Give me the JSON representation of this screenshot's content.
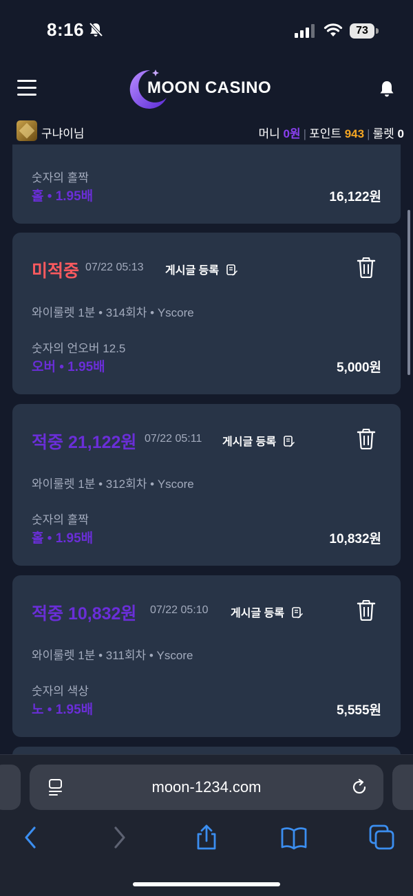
{
  "status_bar": {
    "time": "8:16",
    "battery": "73"
  },
  "header": {
    "logo_text": "MOON CASINO"
  },
  "user": {
    "name": "구냐이님",
    "money_label": "머니",
    "money_value": "0원",
    "point_label": "포인트",
    "point_value": "943",
    "roulette_label": "룰렛",
    "roulette_value": "0"
  },
  "bets": [
    {
      "market": "숫자의 홀짝",
      "pick": "홀 • 1.95배",
      "amount": "16,122원"
    },
    {
      "result": "미적중",
      "status": "lose",
      "date": "07/22 05:13",
      "post_label": "게시글 등록",
      "meta": "와이룰렛 1분 • 314회차 • Yscore",
      "market": "숫자의 언오버 12.5",
      "pick": "오버 • 1.95배",
      "amount": "5,000원"
    },
    {
      "result": "적중 21,122원",
      "status": "win",
      "date": "07/22 05:11",
      "post_label": "게시글 등록",
      "meta": "와이룰렛 1분 • 312회차 • Yscore",
      "market": "숫자의 홀짝",
      "pick": "홀 • 1.95배",
      "amount": "10,832원"
    },
    {
      "result": "적중 10,832원",
      "status": "win",
      "date": "07/22 05:10",
      "post_label": "게시글 등록",
      "meta": "와이룰렛 1분 • 311회차 • Yscore",
      "market": "숫자의 색상",
      "pick": "노 • 1.95배",
      "amount": "5,555원"
    }
  ],
  "browser": {
    "url": "moon-1234.com"
  },
  "colors": {
    "background": "#141a2a",
    "card": "#283447",
    "accent_purple": "#6a2ed8",
    "loss_red": "#ff5a5f",
    "point_orange": "#f5a623"
  }
}
